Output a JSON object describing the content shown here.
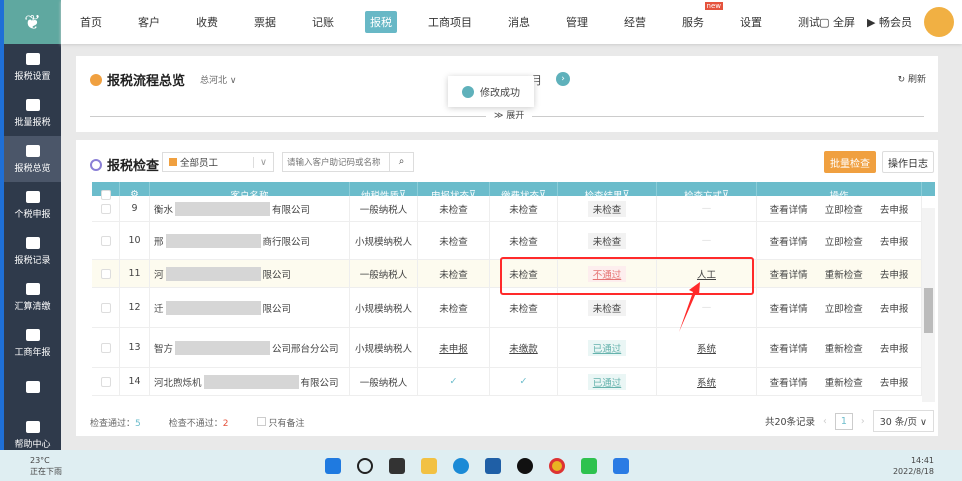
{
  "sidebar": {
    "items": [
      {
        "label": "报税设置",
        "icon": "monitor-gear"
      },
      {
        "label": "批量报税",
        "icon": "monitor-cursor"
      },
      {
        "label": "报税总览",
        "icon": "monitor-tax",
        "active": true
      },
      {
        "label": "个税申报",
        "icon": "user-tax"
      },
      {
        "label": "报税记录",
        "icon": "record"
      },
      {
        "label": "汇算清缴",
        "icon": "percent"
      },
      {
        "label": "工商年报",
        "icon": "calendar-year"
      },
      {
        "label": "",
        "icon": "terminal"
      },
      {
        "label": "帮助中心",
        "icon": "headset"
      }
    ]
  },
  "nav": {
    "items": [
      "首页",
      "客户",
      "收费",
      "票据",
      "记账",
      "报税",
      "工商项目",
      "消息",
      "管理",
      "经营",
      "服务",
      "设置",
      "测试"
    ],
    "active": "报税",
    "new_badge": "new",
    "fullscreen": "全屏",
    "vip": "畅会员"
  },
  "overview": {
    "title": "报税流程总览",
    "region": "总河北",
    "month": "月",
    "refresh": "刷新",
    "expand": "展开",
    "toast": "修改成功"
  },
  "check": {
    "title": "报税检查",
    "staff_select": "全部员工",
    "search_placeholder": "请输入客户助记码或名称",
    "batch_button": "批量检查",
    "log_button": "操作日志",
    "columns": [
      "客户名称",
      "纳税性质",
      "申报状态",
      "缴费状态",
      "检查结果",
      "检查方式",
      "操作"
    ],
    "rows": [
      {
        "idx": "9",
        "name_a": "衡水",
        "name_b": "有限公司",
        "nature": "一般纳税人",
        "declare": "未检查",
        "pay": "未检查",
        "result": "未检查",
        "result_type": "plain",
        "method": "—",
        "ops": [
          "查看详情",
          "立即检查",
          "去申报"
        ]
      },
      {
        "idx": "10",
        "name_a": "邢",
        "name_b": "商行限公司",
        "nature": "小规模纳税人",
        "declare": "未检查",
        "pay": "未检查",
        "result": "未检查",
        "result_type": "plain",
        "method": "—",
        "ops": [
          "查看详情",
          "立即检查",
          "去申报"
        ]
      },
      {
        "idx": "11",
        "name_a": "河",
        "name_b": "限公司",
        "nature": "一般纳税人",
        "declare": "未检查",
        "pay": "未检查",
        "result": "不通过",
        "result_type": "fail",
        "method": "人工",
        "ops": [
          "查看详情",
          "重新检查",
          "去申报"
        ]
      },
      {
        "idx": "12",
        "name_a": "迁",
        "name_b": "限公司",
        "nature": "小规模纳税人",
        "declare": "未检查",
        "pay": "未检查",
        "result": "未检查",
        "result_type": "plain",
        "method": "—",
        "ops": [
          "查看详情",
          "立即检查",
          "去申报"
        ]
      },
      {
        "idx": "13",
        "name_a": "智方",
        "name_b": "公司邢台分公司",
        "nature": "小规模纳税人",
        "declare": "未申报",
        "pay": "未缴款",
        "result": "已通过",
        "result_type": "pass",
        "method": "系统",
        "ops": [
          "查看详情",
          "重新检查",
          "去申报"
        ]
      },
      {
        "idx": "14",
        "name_a": "河北煦烁机",
        "name_b": "有限公司",
        "nature": "一般纳税人",
        "declare": "✓",
        "pay": "✓",
        "result": "已通过",
        "result_type": "pass",
        "method": "系统",
        "ops": [
          "查看详情",
          "重新检查",
          "去申报"
        ]
      }
    ],
    "footer": {
      "pass_label": "检查通过：",
      "pass_count": "5",
      "fail_label": "检查不通过：",
      "fail_count": "2",
      "note_label": "只有备注",
      "total": "共20条记录",
      "page": "1",
      "page_size": "30 条/页"
    }
  },
  "taskbar": {
    "temp": "23°C",
    "weather": "正在下雨",
    "time": "14:41",
    "date": "2022/8/18"
  },
  "colors": {
    "accent": "#6bbccb",
    "orange": "#f0a040",
    "highlight": "#ff2a2a"
  }
}
